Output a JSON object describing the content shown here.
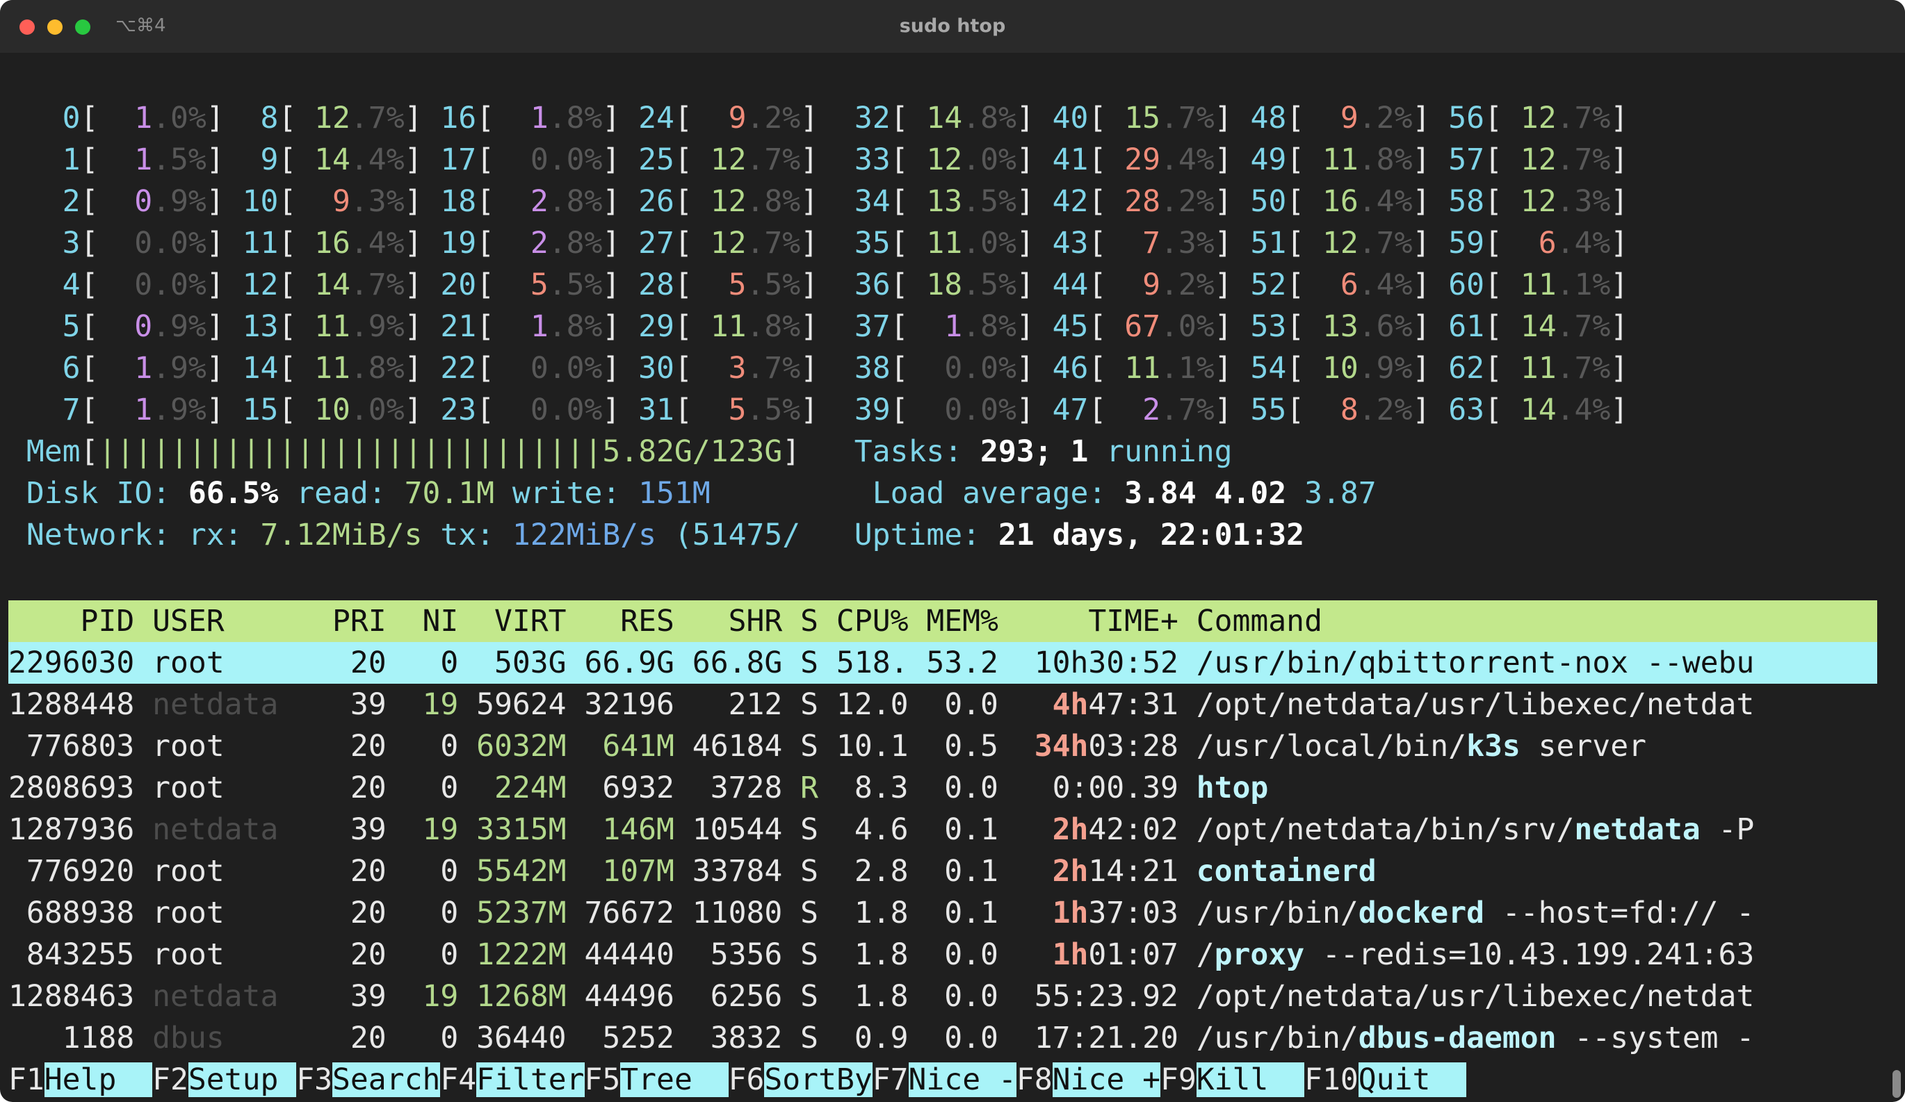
{
  "window": {
    "title": "sudo htop",
    "shortcut": "⌥⌘4"
  },
  "colors": {
    "background": "#1f1f1f",
    "header_bg": "#c3e88c",
    "selected_bg": "#a8f3f8",
    "cyan": "#7fd4e8",
    "green": "#b3d98c",
    "red": "#f08c7a"
  },
  "cpus": [
    {
      "id": "0",
      "value": "1.0%"
    },
    {
      "id": "1",
      "value": "1.5%"
    },
    {
      "id": "2",
      "value": "0.9%"
    },
    {
      "id": "3",
      "value": "0.0%"
    },
    {
      "id": "4",
      "value": "0.0%"
    },
    {
      "id": "5",
      "value": "0.9%"
    },
    {
      "id": "6",
      "value": "1.9%"
    },
    {
      "id": "7",
      "value": "1.9%"
    },
    {
      "id": "8",
      "value": "12.7%"
    },
    {
      "id": "9",
      "value": "14.4%"
    },
    {
      "id": "10",
      "value": "9.3%"
    },
    {
      "id": "11",
      "value": "16.4%"
    },
    {
      "id": "12",
      "value": "14.7%"
    },
    {
      "id": "13",
      "value": "11.9%"
    },
    {
      "id": "14",
      "value": "11.8%"
    },
    {
      "id": "15",
      "value": "10.0%"
    },
    {
      "id": "16",
      "value": "1.8%"
    },
    {
      "id": "17",
      "value": "0.0%"
    },
    {
      "id": "18",
      "value": "2.8%"
    },
    {
      "id": "19",
      "value": "2.8%"
    },
    {
      "id": "20",
      "value": "5.5%"
    },
    {
      "id": "21",
      "value": "1.8%"
    },
    {
      "id": "22",
      "value": "0.0%"
    },
    {
      "id": "23",
      "value": "0.0%"
    },
    {
      "id": "24",
      "value": "9.2%"
    },
    {
      "id": "25",
      "value": "12.7%"
    },
    {
      "id": "26",
      "value": "12.8%"
    },
    {
      "id": "27",
      "value": "12.7%"
    },
    {
      "id": "28",
      "value": "5.5%"
    },
    {
      "id": "29",
      "value": "11.8%"
    },
    {
      "id": "30",
      "value": "3.7%"
    },
    {
      "id": "31",
      "value": "5.5%"
    },
    {
      "id": "32",
      "value": "14.8%"
    },
    {
      "id": "33",
      "value": "12.0%"
    },
    {
      "id": "34",
      "value": "13.5%"
    },
    {
      "id": "35",
      "value": "11.0%"
    },
    {
      "id": "36",
      "value": "18.5%"
    },
    {
      "id": "37",
      "value": "1.8%"
    },
    {
      "id": "38",
      "value": "0.0%"
    },
    {
      "id": "39",
      "value": "0.0%"
    },
    {
      "id": "40",
      "value": "15.7%"
    },
    {
      "id": "41",
      "value": "29.4%"
    },
    {
      "id": "42",
      "value": "28.2%"
    },
    {
      "id": "43",
      "value": "7.3%"
    },
    {
      "id": "44",
      "value": "9.2%"
    },
    {
      "id": "45",
      "value": "67.0%"
    },
    {
      "id": "46",
      "value": "11.1%"
    },
    {
      "id": "47",
      "value": "2.7%"
    },
    {
      "id": "48",
      "value": "9.2%"
    },
    {
      "id": "49",
      "value": "11.8%"
    },
    {
      "id": "50",
      "value": "16.4%"
    },
    {
      "id": "51",
      "value": "12.7%"
    },
    {
      "id": "52",
      "value": "6.4%"
    },
    {
      "id": "53",
      "value": "13.6%"
    },
    {
      "id": "54",
      "value": "10.9%"
    },
    {
      "id": "55",
      "value": "8.2%"
    },
    {
      "id": "56",
      "value": "12.7%"
    },
    {
      "id": "57",
      "value": "12.7%"
    },
    {
      "id": "58",
      "value": "12.3%"
    },
    {
      "id": "59",
      "value": "6.4%"
    },
    {
      "id": "60",
      "value": "11.1%"
    },
    {
      "id": "61",
      "value": "14.7%"
    },
    {
      "id": "62",
      "value": "11.7%"
    },
    {
      "id": "63",
      "value": "14.4%"
    }
  ],
  "meters": {
    "mem_label": "Mem",
    "mem_bar": "||||||||||||||||||||||||||||",
    "mem_value": "5.82G/123G",
    "disk_label": "Disk IO:",
    "disk_pct": "66.5%",
    "disk_read_label": "read:",
    "disk_read": "70.1M",
    "disk_write_label": "write:",
    "disk_write": "151M",
    "net_label": "Network:",
    "net_rx_label": "rx:",
    "net_rx": "7.12MiB/s",
    "net_tx_label": "tx:",
    "net_tx": "122MiB/s",
    "net_extra": "(51475/",
    "tasks_label": "Tasks:",
    "tasks_count": "293;",
    "tasks_running": "1",
    "tasks_running_label": "running",
    "load_label": "Load average:",
    "load_1": "3.84",
    "load_5": "4.02",
    "load_15": "3.87",
    "uptime_label": "Uptime:",
    "uptime": "21 days, 22:01:32"
  },
  "table": {
    "headers": [
      "PID",
      "USER",
      "PRI",
      "NI",
      "VIRT",
      "RES",
      "SHR",
      "S",
      "CPU%",
      "MEM%",
      "TIME+",
      "Command"
    ],
    "rows": [
      {
        "pid": "2296030",
        "user": "root",
        "pri": "20",
        "ni": "0",
        "virt": "503G",
        "res": "66.9G",
        "shr": "66.8G",
        "s": "S",
        "cpu": "518.",
        "mem": "53.2",
        "time_h": "10h",
        "time_rest": "30:52",
        "cmd_pre": "/usr/bin/qbittorrent-nox --webu",
        "cmd_bold": "",
        "cmd_post": ""
      },
      {
        "pid": "1288448",
        "user": "netdata",
        "pri": "39",
        "ni": "19",
        "virt": "59624",
        "res": "32196",
        "shr": "212",
        "s": "S",
        "cpu": "12.0",
        "mem": "0.0",
        "time_h": "4h",
        "time_rest": "47:31",
        "cmd_pre": "/opt/netdata/usr/libexec/netdat",
        "cmd_bold": "",
        "cmd_post": ""
      },
      {
        "pid": "776803",
        "user": "root",
        "pri": "20",
        "ni": "0",
        "virt": "6032M",
        "res": "641M",
        "shr": "46184",
        "s": "S",
        "cpu": "10.1",
        "mem": "0.5",
        "time_h": "34h",
        "time_rest": "03:28",
        "cmd_pre": "/usr/local/bin/",
        "cmd_bold": "k3s",
        "cmd_post": " server"
      },
      {
        "pid": "2808693",
        "user": "root",
        "pri": "20",
        "ni": "0",
        "virt": "224M",
        "res": "6932",
        "shr": "3728",
        "s": "R",
        "cpu": "8.3",
        "mem": "0.0",
        "time_h": "",
        "time_rest": "0:00.39",
        "cmd_pre": "",
        "cmd_bold": "htop",
        "cmd_post": ""
      },
      {
        "pid": "1287936",
        "user": "netdata",
        "pri": "39",
        "ni": "19",
        "virt": "3315M",
        "res": "146M",
        "shr": "10544",
        "s": "S",
        "cpu": "4.6",
        "mem": "0.1",
        "time_h": "2h",
        "time_rest": "42:02",
        "cmd_pre": "/opt/netdata/bin/srv/",
        "cmd_bold": "netdata",
        "cmd_post": " -P"
      },
      {
        "pid": "776920",
        "user": "root",
        "pri": "20",
        "ni": "0",
        "virt": "5542M",
        "res": "107M",
        "shr": "33784",
        "s": "S",
        "cpu": "2.8",
        "mem": "0.1",
        "time_h": "2h",
        "time_rest": "14:21",
        "cmd_pre": "",
        "cmd_bold": "containerd",
        "cmd_post": ""
      },
      {
        "pid": "688938",
        "user": "root",
        "pri": "20",
        "ni": "0",
        "virt": "5237M",
        "res": "76672",
        "shr": "11080",
        "s": "S",
        "cpu": "1.8",
        "mem": "0.1",
        "time_h": "1h",
        "time_rest": "37:03",
        "cmd_pre": "/usr/bin/",
        "cmd_bold": "dockerd",
        "cmd_post": " --host=fd:// -"
      },
      {
        "pid": "843255",
        "user": "root",
        "pri": "20",
        "ni": "0",
        "virt": "1222M",
        "res": "44440",
        "shr": "5356",
        "s": "S",
        "cpu": "1.8",
        "mem": "0.0",
        "time_h": "1h",
        "time_rest": "01:07",
        "cmd_pre": "/",
        "cmd_bold": "proxy",
        "cmd_post": " --redis=10.43.199.241:63"
      },
      {
        "pid": "1288463",
        "user": "netdata",
        "pri": "39",
        "ni": "19",
        "virt": "1268M",
        "res": "44496",
        "shr": "6256",
        "s": "S",
        "cpu": "1.8",
        "mem": "0.0",
        "time_h": "",
        "time_rest": "55:23.92",
        "cmd_pre": "/opt/netdata/usr/libexec/netdat",
        "cmd_bold": "",
        "cmd_post": ""
      },
      {
        "pid": "1188",
        "user": "dbus",
        "pri": "20",
        "ni": "0",
        "virt": "36440",
        "res": "5252",
        "shr": "3832",
        "s": "S",
        "cpu": "0.9",
        "mem": "0.0",
        "time_h": "",
        "time_rest": "17:21.20",
        "cmd_pre": "/usr/bin/",
        "cmd_bold": "dbus-daemon",
        "cmd_post": " --system -"
      }
    ]
  },
  "fkeys": [
    {
      "key": "F1",
      "label": "Help  "
    },
    {
      "key": "F2",
      "label": "Setup "
    },
    {
      "key": "F3",
      "label": "Search"
    },
    {
      "key": "F4",
      "label": "Filter"
    },
    {
      "key": "F5",
      "label": "Tree  "
    },
    {
      "key": "F6",
      "label": "SortBy"
    },
    {
      "key": "F7",
      "label": "Nice -"
    },
    {
      "key": "F8",
      "label": "Nice +"
    },
    {
      "key": "F9",
      "label": "Kill  "
    },
    {
      "key": "F10",
      "label": "Quit  "
    }
  ]
}
